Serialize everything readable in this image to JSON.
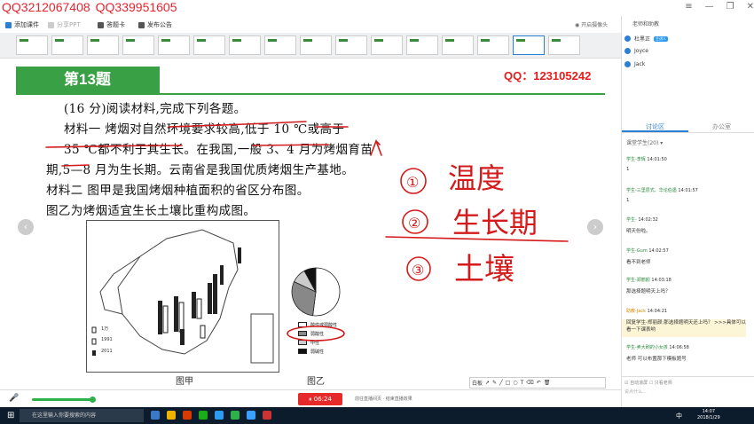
{
  "watermark": {
    "qq1": "QQ3212067408",
    "qq2": "QQ339951605"
  },
  "topbar": {
    "add_label": "添加课件",
    "share_label": "分享PPT",
    "answer_label": "答题卡",
    "notice_label": "发布公告",
    "camera_label": "开启摄像头"
  },
  "slide": {
    "title": "第13题",
    "qq": "QQ：123105242",
    "lines": [
      "(16 分)阅读材料,完成下列各题。",
      "材料一    烤烟对自然环境要求较高,低于 10 ℃或高于",
      "35 ℃都不利于其生长。在我国,一般 3、4 月为烤烟育苗",
      "期,5—8 月为生长期。云南省是我国优质烤烟生产基地。",
      "材料二    图甲是我国烤烟种植面积的省区分布图。",
      "图乙为烤烟适宜生长土壤比重构成图。"
    ],
    "map_legend": [
      "1万",
      "1991",
      "2011"
    ],
    "pie_legend": [
      "酸性或弱酸性",
      "弱酸性",
      "中性",
      "弱碱性"
    ],
    "caption_a": "图甲",
    "caption_b": "图乙",
    "pie_values": [
      0.52,
      0.3,
      0.1,
      0.08
    ]
  },
  "handwriting": {
    "items": [
      "温度",
      "生长期",
      "土壤"
    ],
    "nums": [
      "①",
      "②",
      "③"
    ]
  },
  "drawtools": {
    "label": "白板"
  },
  "bottom": {
    "timer": "06:24",
    "live_text": "前往直播间页 · 结束直播效果"
  },
  "sidebar": {
    "title": "老师和助教",
    "users": [
      {
        "name": "杜黑正",
        "badge": "主讲人"
      },
      {
        "name": "Joyce",
        "badge": ""
      },
      {
        "name": "Jack",
        "badge": ""
      }
    ],
    "tab_discuss": "讨论区",
    "tab_office": "办公室",
    "filter": "课堂学生(20)",
    "messages": [
      {
        "who": "学生-李辉",
        "time": "14:01:50",
        "body": "1"
      },
      {
        "who": "学生-三里层式、华论伯遇",
        "time": "14:01:57",
        "body": "1"
      },
      {
        "who": "学生-",
        "time": "14:02:32",
        "body": "明天份啦。"
      },
      {
        "who": "学生-Gum",
        "time": "14:02:57",
        "body": "看不到老师"
      },
      {
        "who": "学生-郑丽颜",
        "time": "14:03:18",
        "body": "那选择题明天上吗？"
      },
      {
        "who": "助教-Jack",
        "time": "14:04:21",
        "body": "回复学生-郑丽颜:那选择题明天还上吗？ >>>具体可以看一下课表哟"
      },
      {
        "who": "学生-卖大刷的小女孩",
        "time": "14:06:58",
        "body": "老师 可以布置那下模板题号"
      }
    ],
    "auto_scroll": "自动滚屏",
    "only_teacher": "只看老师",
    "input_placeholder": "说点什么..."
  },
  "taskbar": {
    "search": "在这里输入你要搜索的内容",
    "time": "14:07",
    "date": "2018/1/29",
    "lang": "中"
  }
}
